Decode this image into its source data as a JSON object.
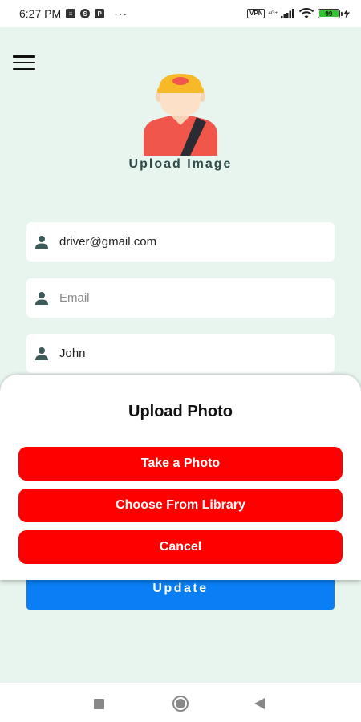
{
  "status_bar": {
    "time": "6:27 PM",
    "notification_icons": [
      "news-icon",
      "s-app-icon",
      "p-app-icon"
    ],
    "more_dots": "···",
    "vpn": "VPN",
    "network": "4G+",
    "battery_level": "99",
    "battery_fraction": 0.99
  },
  "profile": {
    "upload_label": "Upload Image"
  },
  "fields": {
    "username": {
      "value": "driver@gmail.com",
      "placeholder": ""
    },
    "email": {
      "value": "",
      "placeholder": "Email"
    },
    "name": {
      "value": "John",
      "placeholder": ""
    }
  },
  "update_button": "Update",
  "sheet": {
    "title": "Upload Photo",
    "take_photo": "Take a Photo",
    "choose_library": "Choose From Library",
    "cancel": "Cancel"
  },
  "colors": {
    "background": "#e8f5ee",
    "sheet_button": "#ff0000",
    "update_button": "#0a7ff5",
    "label_text": "#2e4a4a",
    "person_icon": "#3d5a5a"
  }
}
